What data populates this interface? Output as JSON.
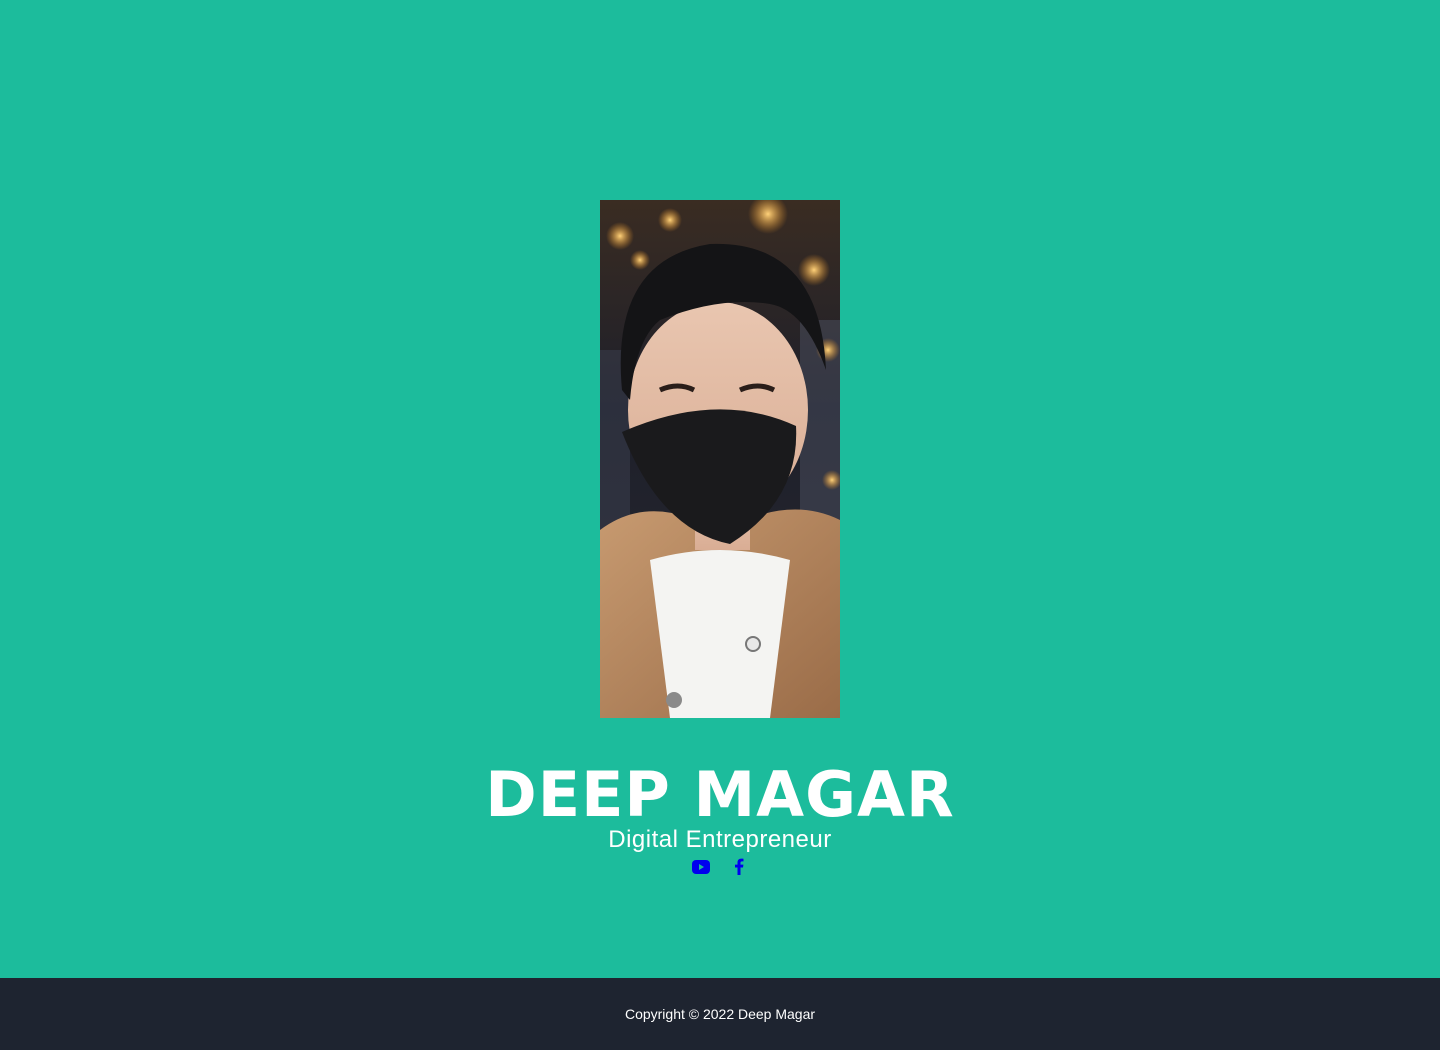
{
  "profile": {
    "name": "DEEP MAGAR",
    "tagline": "Digital Entrepreneur",
    "photo_icon": "portrait-photo"
  },
  "social": {
    "items": [
      {
        "icon": "youtube-icon"
      },
      {
        "icon": "facebook-icon"
      }
    ],
    "link_color": "#0000ee"
  },
  "footer": {
    "copyright": "Copyright © 2022 Deep Magar"
  },
  "colors": {
    "background": "#1cbc9c",
    "footer": "#1e2430",
    "text": "#ffffff"
  }
}
